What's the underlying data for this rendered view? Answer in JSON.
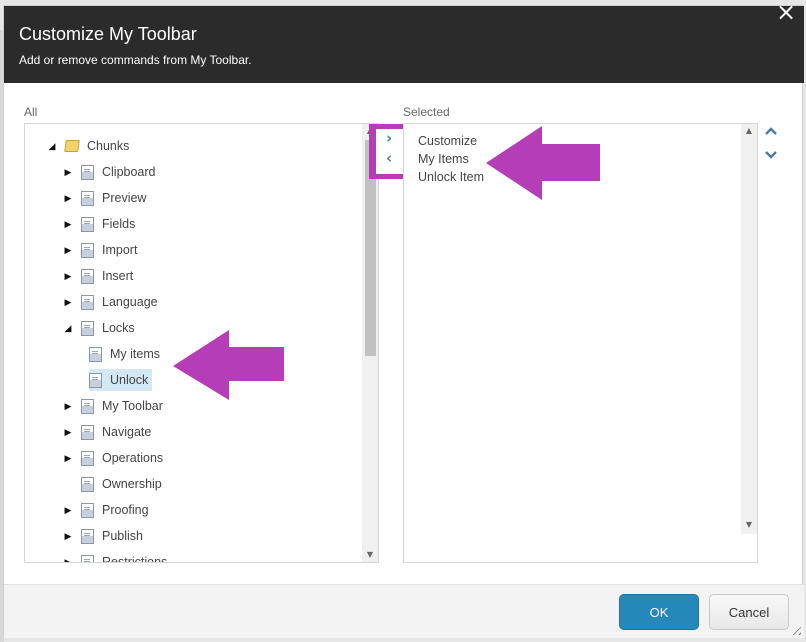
{
  "dialog": {
    "title": "Customize My Toolbar",
    "subtitle": "Add or remove commands from My Toolbar.",
    "close_icon": "×"
  },
  "all_panel": {
    "label": "All",
    "tree": [
      {
        "label": "Chunks",
        "level": 0,
        "expander": "expanded",
        "icon": "folder-icon"
      },
      {
        "label": "Clipboard",
        "level": 1,
        "expander": "collapsed",
        "icon": "document-icon"
      },
      {
        "label": "Preview",
        "level": 1,
        "expander": "collapsed",
        "icon": "document-icon"
      },
      {
        "label": "Fields",
        "level": 1,
        "expander": "collapsed",
        "icon": "document-icon"
      },
      {
        "label": "Import",
        "level": 1,
        "expander": "collapsed",
        "icon": "document-icon"
      },
      {
        "label": "Insert",
        "level": 1,
        "expander": "collapsed",
        "icon": "document-icon"
      },
      {
        "label": "Language",
        "level": 1,
        "expander": "collapsed",
        "icon": "document-icon"
      },
      {
        "label": "Locks",
        "level": 1,
        "expander": "expanded",
        "icon": "document-icon"
      },
      {
        "label": "My items",
        "level": 2,
        "expander": "none",
        "icon": "document-icon"
      },
      {
        "label": "Unlock",
        "level": 2,
        "expander": "none",
        "icon": "document-icon",
        "selected": true
      },
      {
        "label": "My Toolbar",
        "level": 1,
        "expander": "collapsed",
        "icon": "document-icon"
      },
      {
        "label": "Navigate",
        "level": 1,
        "expander": "collapsed",
        "icon": "document-icon"
      },
      {
        "label": "Operations",
        "level": 1,
        "expander": "collapsed",
        "icon": "document-icon"
      },
      {
        "label": "Ownership",
        "level": 1,
        "expander": "none",
        "icon": "document-icon"
      },
      {
        "label": "Proofing",
        "level": 1,
        "expander": "collapsed",
        "icon": "document-icon"
      },
      {
        "label": "Publish",
        "level": 1,
        "expander": "collapsed",
        "icon": "document-icon"
      },
      {
        "label": "Restrictions",
        "level": 1,
        "expander": "collapsed",
        "icon": "document-icon"
      }
    ]
  },
  "move_buttons": {
    "add": "›",
    "remove": "‹"
  },
  "selected_panel": {
    "label": "Selected",
    "items": [
      "Customize",
      "My Items",
      "Unlock Item"
    ]
  },
  "order_buttons": {
    "up": "⌃",
    "down": "⌄"
  },
  "annotation_color": "#b53db8",
  "footer": {
    "ok_label": "OK",
    "cancel_label": "Cancel"
  }
}
